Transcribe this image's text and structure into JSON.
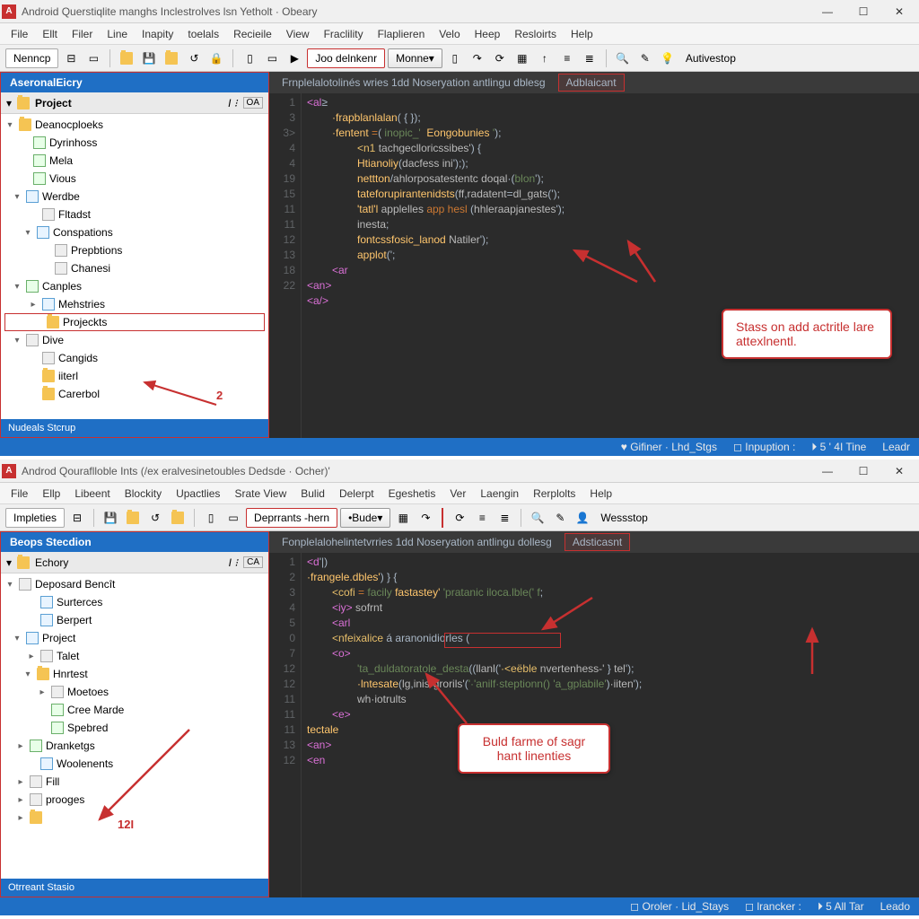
{
  "app1": {
    "title": "Android Querstiqlite manghs Inclestrolves lsn Yetholt · Obeary",
    "menu": [
      "File",
      "Ellt",
      "Filer",
      "Line",
      "Inapity",
      "toelals",
      "Recieile",
      "View",
      "Fraclility",
      "Flaplieren",
      "Velo",
      "Heep",
      "Resloirts",
      "Help"
    ],
    "toolbar_nemp": "Nenncp",
    "toolbar_run": "Joo delnkenr",
    "toolbar_combo": "Monne",
    "toolbar_right": "Autivestop",
    "side_tab": "AseronalEicry",
    "side_head": "Project",
    "side_oa": "OA",
    "tree": {
      "root": "Deanocploeks",
      "n1": "Dyrinhoss",
      "n2": "Mela",
      "n3": "Vious",
      "n4": "Werdbe",
      "n5": "Fltadst",
      "n6": "Conspations",
      "n7": "Prepbtions",
      "n8": "Chanesi",
      "n9": "Canples",
      "n10": "Mehstries",
      "n11": "Projeckts",
      "n12": "Dive",
      "n13": "Cangids",
      "n14": "iiterl",
      "n15": "Carerbol"
    },
    "badge2": "2",
    "side_foot": "Nudeals Stcrup",
    "ed_tab1": "Frnplelalotolinés wries 1dd Noseryation antlingu dblesg",
    "ed_tab2": "Adblaicant",
    "gutter": [
      "1",
      "3",
      "3>",
      "4",
      "4",
      "19",
      "15",
      "11",
      "11",
      "12",
      "13",
      "18",
      "22"
    ],
    "code": [
      {
        "indent": 0,
        "html": "<span class='m'>&lt;al</span>&ge;"
      },
      {
        "indent": 1,
        "html": "<span class='y'>·frapblanlalan</span>( <span class='br'>{ }</span>);"
      },
      {
        "indent": 1,
        "html": "<span class='y'>·fentent</span> <span class='k'>=</span>( <span class='s'>inopic_'</span>  <span class='y'>Eongobunies</span> <span class='s'>'</span>);"
      },
      {
        "indent": 2,
        "html": "<span class='t'>&lt;n1</span> <span class='a'>tachgeclloricssibes'</span>) {"
      },
      {
        "indent": 2,
        "html": "<span class='y'>Htianoliy</span>(<span class='a'>dacfess ini</span>'););"
      },
      {
        "indent": 2,
        "html": "<span class='y'>nettton</span>/<span class='a'>ahlorposatestentc doqal</span>·(<span class='s'>blon</span>');"
      },
      {
        "indent": 2,
        "html": "<span class='y'>tateforupirantenidsts</span>(<span class='a'>ff</span>,<span class='a'>radatent</span>=<span class='a'>dl_gats</span>(');"
      },
      {
        "indent": 2,
        "html": "<span class='y'>'tatl'l</span> <span class='a'>applelles</span> <span class='k'>app hesl</span> (<span class='a'>hhleraapjanestes</span>');"
      },
      {
        "indent": 2,
        "html": "<span class='a'>inesta</span>;"
      },
      {
        "indent": 2,
        "html": "<span class='y'>fontcssfosic_lanod</span> <span class='a'>Natiler</span>');"
      },
      {
        "indent": 2,
        "html": "<span class='y'>applot</span>(';"
      },
      {
        "indent": 1,
        "html": "<span class='m'>&lt;ar</span>"
      },
      {
        "indent": 0,
        "html": "<span class='m'>&lt;an&gt;</span>"
      },
      {
        "indent": 0,
        "html": "<span class='m'>&lt;a/&gt;</span>"
      }
    ],
    "callout": "Stass on add actritle lare attexlnentl.",
    "status": {
      "a": "♥ Gifiner · Lhd_Stgs",
      "b": "◻ Inpuption :",
      "c": "⏵ 5 ' 4I  Tine",
      "d": "Leadr"
    }
  },
  "app2": {
    "title": "Androd Qouraflloble Ints (/ex  eralvesinetoubles Dedsde · Ocher)'",
    "menu": [
      "File",
      "Ellp",
      "Libeent",
      "Blockity",
      "Upactlies",
      "Srate View",
      "Bulid",
      "Delerpt",
      "Egeshetis",
      "Ver",
      "Laengin",
      "Rerplolts",
      "Help"
    ],
    "toolbar_imp": "Impleties",
    "toolbar_dep": "Deprrants -hern",
    "toolbar_combo": "Bude",
    "toolbar_right": "Wessstop",
    "side_tab": "Beops Stecdion",
    "side_head": "Echory",
    "side_oa": "CA",
    "tree": {
      "root": "Deposard Bencît",
      "n1": "Surterces",
      "n2": "Berpert",
      "n3": "Project",
      "n4": "Talet",
      "n5": "Hnrtest",
      "n6": "Moetoes",
      "n7": "Cree Marde",
      "n8": "Spebred",
      "n9": "Dranketgs",
      "n10": "Woolenents",
      "n11": "Fill",
      "n12": "prooges"
    },
    "badge12": "12I",
    "side_foot": "Otrreant Stasio",
    "ed_tab1": "Fonplelalohelintetvrries 1dd Noseryation antlingu dollesg",
    "ed_tab2": "Adsticasnt",
    "gutter": [
      "1",
      "2",
      "3",
      "4",
      "5",
      "0",
      "7",
      "12",
      "12",
      "11",
      "11",
      "11",
      "13",
      "12"
    ],
    "code": [
      {
        "indent": 0,
        "html": "<span class='m'>&lt;d</span>'|)"
      },
      {
        "indent": 0,
        "html": "<span class='y'>·frangele.dbles'</span>) } {"
      },
      {
        "indent": 1,
        "html": "<span class='t'>&lt;cofi</span> <span class='k'>=</span> <span class='s'>facily</span> <span class='y'>fastastey'</span> <span class='s'>'pratanic iloca.lble(' f</span>;"
      },
      {
        "indent": 1,
        "html": "<span class='m'>&lt;iy&gt;</span> <span class='a'>sofrnt</span>"
      },
      {
        "indent": 1,
        "html": "<span class='m'>&lt;arl</span>"
      },
      {
        "indent": 1,
        "html": "<span class='t'>&lt;nfeixalice</span><span class='redinline'> á aranonidiorles (</span>"
      },
      {
        "indent": 1,
        "html": "<span class='m'>&lt;o&gt;</span>"
      },
      {
        "indent": 2,
        "html": "<span class='s'>'ta_duldatoratole_desta</span>((<span class='a'>llanl</span>('<span class='t'>·&lt;eëble</span> <span class='a'>nvertenhess-'</span> } <span class='a'>tel</span>');"
      },
      {
        "indent": 2,
        "html": "<span class='y'>·lntesate</span>(<span class='a'>lg</span>,<span class='a'>inis·grorils'</span>(<span class='s'>'·'anilf·steptionn()</span> <span class='s'>'a_gplabile'</span>)<span class='a'>·iiten</span>');"
      },
      {
        "indent": 2,
        "html": "<span class='a'>wh·iotrults</span>"
      },
      {
        "indent": 1,
        "html": "<span class='m'>&lt;e&gt;</span>"
      },
      {
        "indent": 0,
        "html": "<span class='y'>tectale</span>"
      },
      {
        "indent": 0,
        "html": "<span class='m'>&lt;an&gt;</span>"
      },
      {
        "indent": 0,
        "html": "<span class='m'>&lt;en</span>"
      }
    ],
    "callout": "Buld farme of sagr hant linenties",
    "status": {
      "a": "◻ Oroler · Lid_Stays",
      "b": "◻ lrancker :",
      "c": "⏵ 5   All Tar",
      "d": "Leado"
    }
  }
}
